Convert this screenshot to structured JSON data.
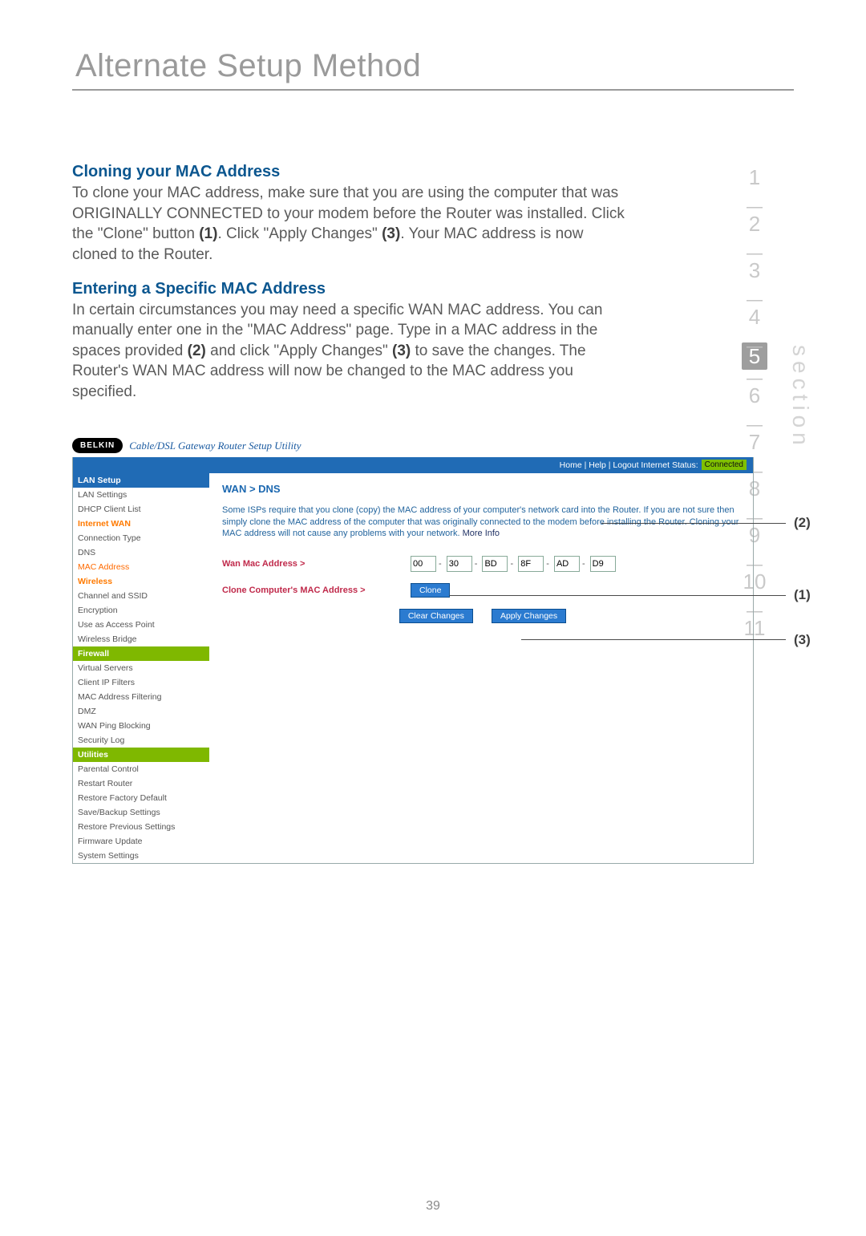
{
  "page": {
    "title": "Alternate Setup Method",
    "number": "39",
    "section_label": "section"
  },
  "section_nav": {
    "numbers": [
      "1",
      "2",
      "3",
      "4",
      "5",
      "6",
      "7",
      "8",
      "9",
      "10",
      "11"
    ],
    "active": "5"
  },
  "headings": {
    "clone": "Cloning your MAC Address",
    "enter": "Entering a Specific MAC Address"
  },
  "paragraphs": {
    "clone_a": "To clone your MAC address, make sure that you are using the computer that was ORIGINALLY CONNECTED to your modem before the Router was installed. Click the \"Clone\" button ",
    "clone_b": ". Click \"Apply Changes\" ",
    "clone_c": ". Your MAC address is now cloned to the Router.",
    "enter_a": "In certain circumstances you may need a specific WAN MAC address. You can manually enter one in the \"MAC Address\" page. Type in a MAC address in the spaces provided ",
    "enter_b": " and click \"Apply Changes\" ",
    "enter_c": " to save the changes. The Router's WAN MAC address will now be changed to the MAC address you specified.",
    "ref1": "(1)",
    "ref2": "(2)",
    "ref3": "(3)"
  },
  "callouts": {
    "c1": "(1)",
    "c2": "(2)",
    "c3": "(3)"
  },
  "ui": {
    "brand": "BELKIN",
    "tagline": "Cable/DSL Gateway Router Setup Utility",
    "topbar_links": "Home | Help | Logout    Internet Status:",
    "status": "Connected",
    "side_groups": [
      {
        "header": "LAN Setup",
        "items": [
          "LAN Settings",
          "DHCP Client List"
        ]
      },
      {
        "header_style": "orange",
        "header": "Internet WAN",
        "items": [
          "Connection Type",
          "DNS",
          "MAC Address"
        ],
        "selected": "MAC Address"
      },
      {
        "header_style": "orange",
        "header": "Wireless",
        "items": [
          "Channel and SSID",
          "Encryption",
          "Use as Access Point",
          "Wireless Bridge"
        ]
      },
      {
        "header_style": "green",
        "header": "Firewall",
        "items": [
          "Virtual Servers",
          "Client IP Filters",
          "MAC Address Filtering",
          "DMZ",
          "WAN Ping Blocking",
          "Security Log"
        ]
      },
      {
        "header_style": "green",
        "header": "Utilities",
        "items": [
          "Parental Control",
          "Restart Router",
          "Restore Factory Default",
          "Save/Backup Settings",
          "Restore Previous Settings",
          "Firmware Update",
          "System Settings"
        ]
      }
    ],
    "crumb": "WAN > DNS",
    "description": "Some ISPs require that you clone (copy) the MAC address of your computer's network card into the Router. If you are not sure then simply clone the MAC address of the computer that was originally connected to the modem before installing the Router. Cloning your MAC address will not cause any problems with your network.",
    "more_info": "More Info",
    "wan_mac_label": "Wan Mac Address >",
    "mac": [
      "00",
      "30",
      "BD",
      "8F",
      "AD",
      "D9"
    ],
    "clone_label": "Clone Computer's MAC Address >",
    "clone_btn": "Clone",
    "clear_btn": "Clear Changes",
    "apply_btn": "Apply Changes"
  }
}
